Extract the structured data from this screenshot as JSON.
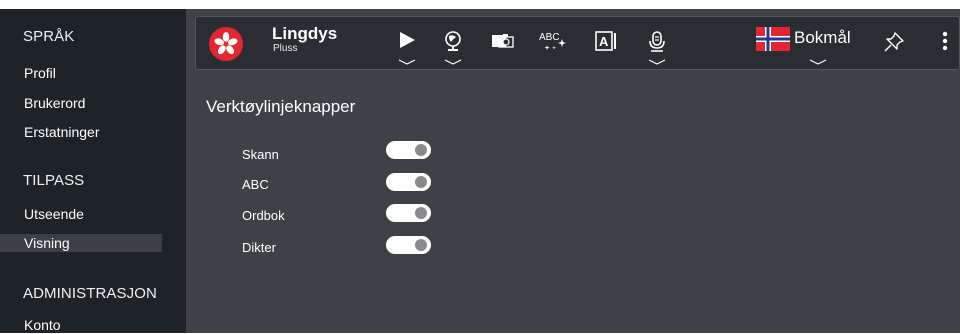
{
  "sidebar": {
    "sections": [
      {
        "title": "SPRÅK",
        "items": [
          "Profil",
          "Brukerord",
          "Erstatninger"
        ]
      },
      {
        "title": "TILPASS",
        "items": [
          "Utseende",
          "Visning"
        ]
      },
      {
        "title": "ADMINISTRASJON",
        "items": [
          "Konto"
        ]
      }
    ],
    "selected_item": "Visning"
  },
  "toolbar": {
    "brand_name": "Lingdys",
    "brand_sub": "Pluss",
    "abc_label": "ABC",
    "language_label": "Bokmål",
    "icons": [
      "lingdys-logo-icon",
      "play-icon",
      "globe-icon",
      "camera-scan-icon",
      "abc-spell-icon",
      "text-predict-icon",
      "microphone-icon",
      "norway-flag-icon",
      "pin-icon",
      "more-vertical-icon"
    ]
  },
  "main": {
    "title": "Verktøylinjeknapper",
    "options": [
      {
        "label": "Skann",
        "enabled": true
      },
      {
        "label": "ABC",
        "enabled": true
      },
      {
        "label": "Ordbok",
        "enabled": true
      },
      {
        "label": "Dikter",
        "enabled": true
      }
    ]
  },
  "colors": {
    "sidebar_bg": "#1e2327",
    "main_bg": "#3e4246",
    "toolbar_bg": "#2a2e32",
    "accent_red": "#e3262f",
    "toggle_on": "#ffffff"
  }
}
